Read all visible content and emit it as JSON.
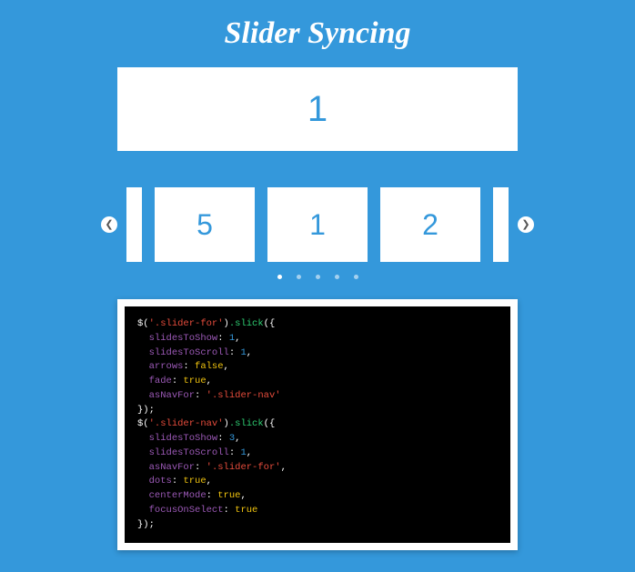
{
  "title": "Slider Syncing",
  "slider_for": {
    "current": "1"
  },
  "slider_nav": {
    "slides": [
      "5",
      "1",
      "2"
    ],
    "dot_count": 5,
    "active_dot": 0
  },
  "code": {
    "call1_selector": "'.slider-for'",
    "call1_method": ".slick",
    "opts1": {
      "slidesToShow": "1",
      "slidesToScroll": "1",
      "arrows": "false",
      "fade": "true",
      "asNavFor": "'.slider-nav'"
    },
    "call2_selector": "'.slider-nav'",
    "call2_method": ".slick",
    "opts2": {
      "slidesToShow": "3",
      "slidesToScroll": "1",
      "asNavFor": "'.slider-for'",
      "dots": "true",
      "centerMode": "true",
      "focusOnSelect": "true"
    }
  }
}
